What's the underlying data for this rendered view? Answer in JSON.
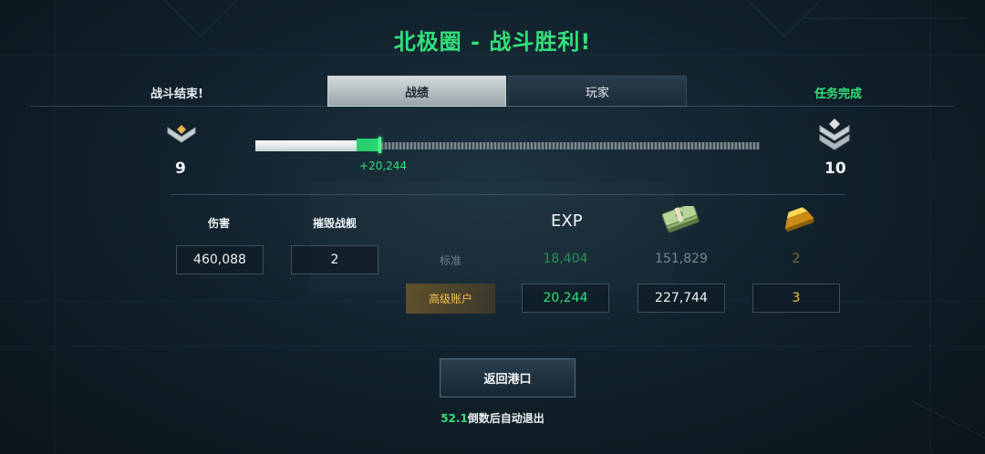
{
  "title": "北极圈 - 战斗胜利!",
  "header": {
    "left_status": "战斗结束!",
    "right_status": "任务完成",
    "tabs": [
      {
        "label": "战绩",
        "active": true
      },
      {
        "label": "玩家",
        "active": false
      }
    ]
  },
  "rank": {
    "current_level": "9",
    "next_level": "10",
    "progress_gain": "+20,244",
    "progress_fraction": 0.25
  },
  "stats": {
    "damage_label": "伤害",
    "damage_value": "460,088",
    "destroyed_label": "摧毁战舰",
    "destroyed_value": "2"
  },
  "rewards": {
    "exp_label": "EXP",
    "money_icon": "cash-stack-icon",
    "gold_icon": "gold-bar-icon",
    "standard": {
      "label": "标准",
      "exp": "18,404",
      "credits": "151,829",
      "gold": "2"
    },
    "premium": {
      "label": "高级账户",
      "exp": "20,244",
      "credits": "227,744",
      "gold": "3"
    }
  },
  "actions": {
    "return_label": "返回港口",
    "countdown_number": "52.1",
    "countdown_text": "倒数后自动退出"
  },
  "colors": {
    "accent_green": "#33e07a",
    "gold": "#f2c24a"
  }
}
